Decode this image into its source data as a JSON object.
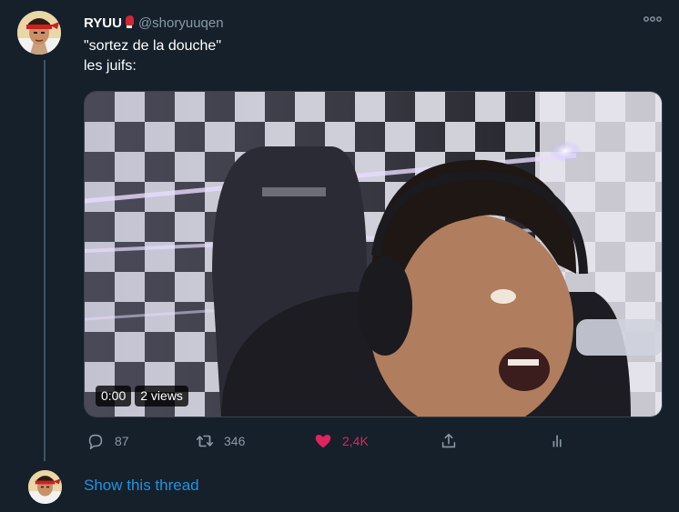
{
  "tweet": {
    "author_name": "RYUU",
    "author_emoji": "boxing-glove-icon",
    "handle": "@shoryuuqen",
    "text_lines": [
      "\"sortez de la douche\"",
      "les juifs:"
    ],
    "more_icon": "more-icon"
  },
  "media": {
    "time": "0:00",
    "views": "2 views"
  },
  "actions": {
    "reply_count": "87",
    "retweet_count": "346",
    "like_count": "2,4K",
    "like_color": "#e0245e"
  },
  "thread": {
    "show_label": "Show this thread"
  },
  "colors": {
    "background": "#15202b",
    "secondary_text": "#8899a6",
    "link": "#1b95e0",
    "thread_line": "#3d5466"
  }
}
